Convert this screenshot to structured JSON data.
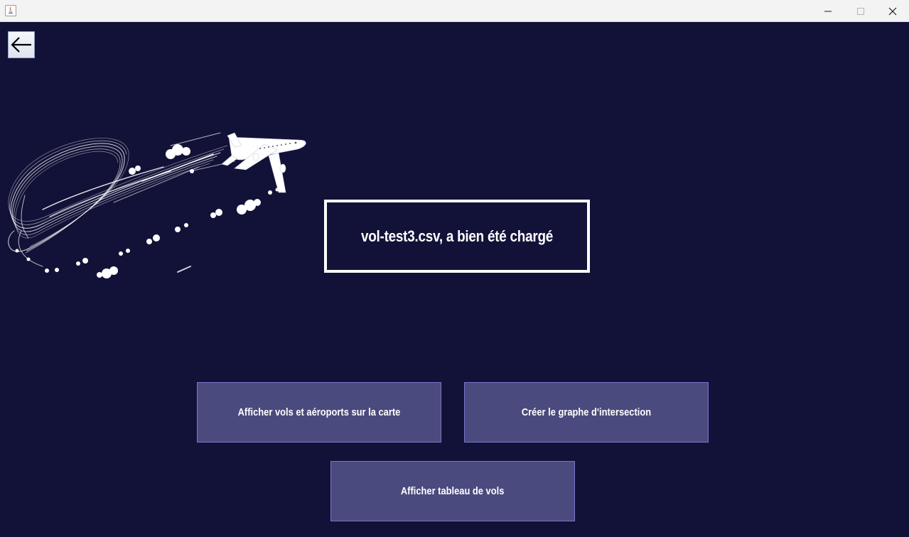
{
  "window": {
    "controls": {
      "minimize_icon": "minimize-icon",
      "maximize_icon": "maximize-icon",
      "close_icon": "close-icon"
    }
  },
  "toolbar": {
    "back_icon": "arrow-left-icon"
  },
  "status": {
    "message": "vol-test3.csv, a bien été chargé"
  },
  "actions": {
    "show_map_label": "Afficher vols et aéroports sur la carte",
    "create_graph_label": "Créer le graphe d'intersection",
    "show_table_label": "Afficher tableau de vols"
  },
  "colors": {
    "background": "#121238",
    "button_fill": "#4a4a7e",
    "button_border": "#7777cc",
    "text": "#ffffff"
  }
}
